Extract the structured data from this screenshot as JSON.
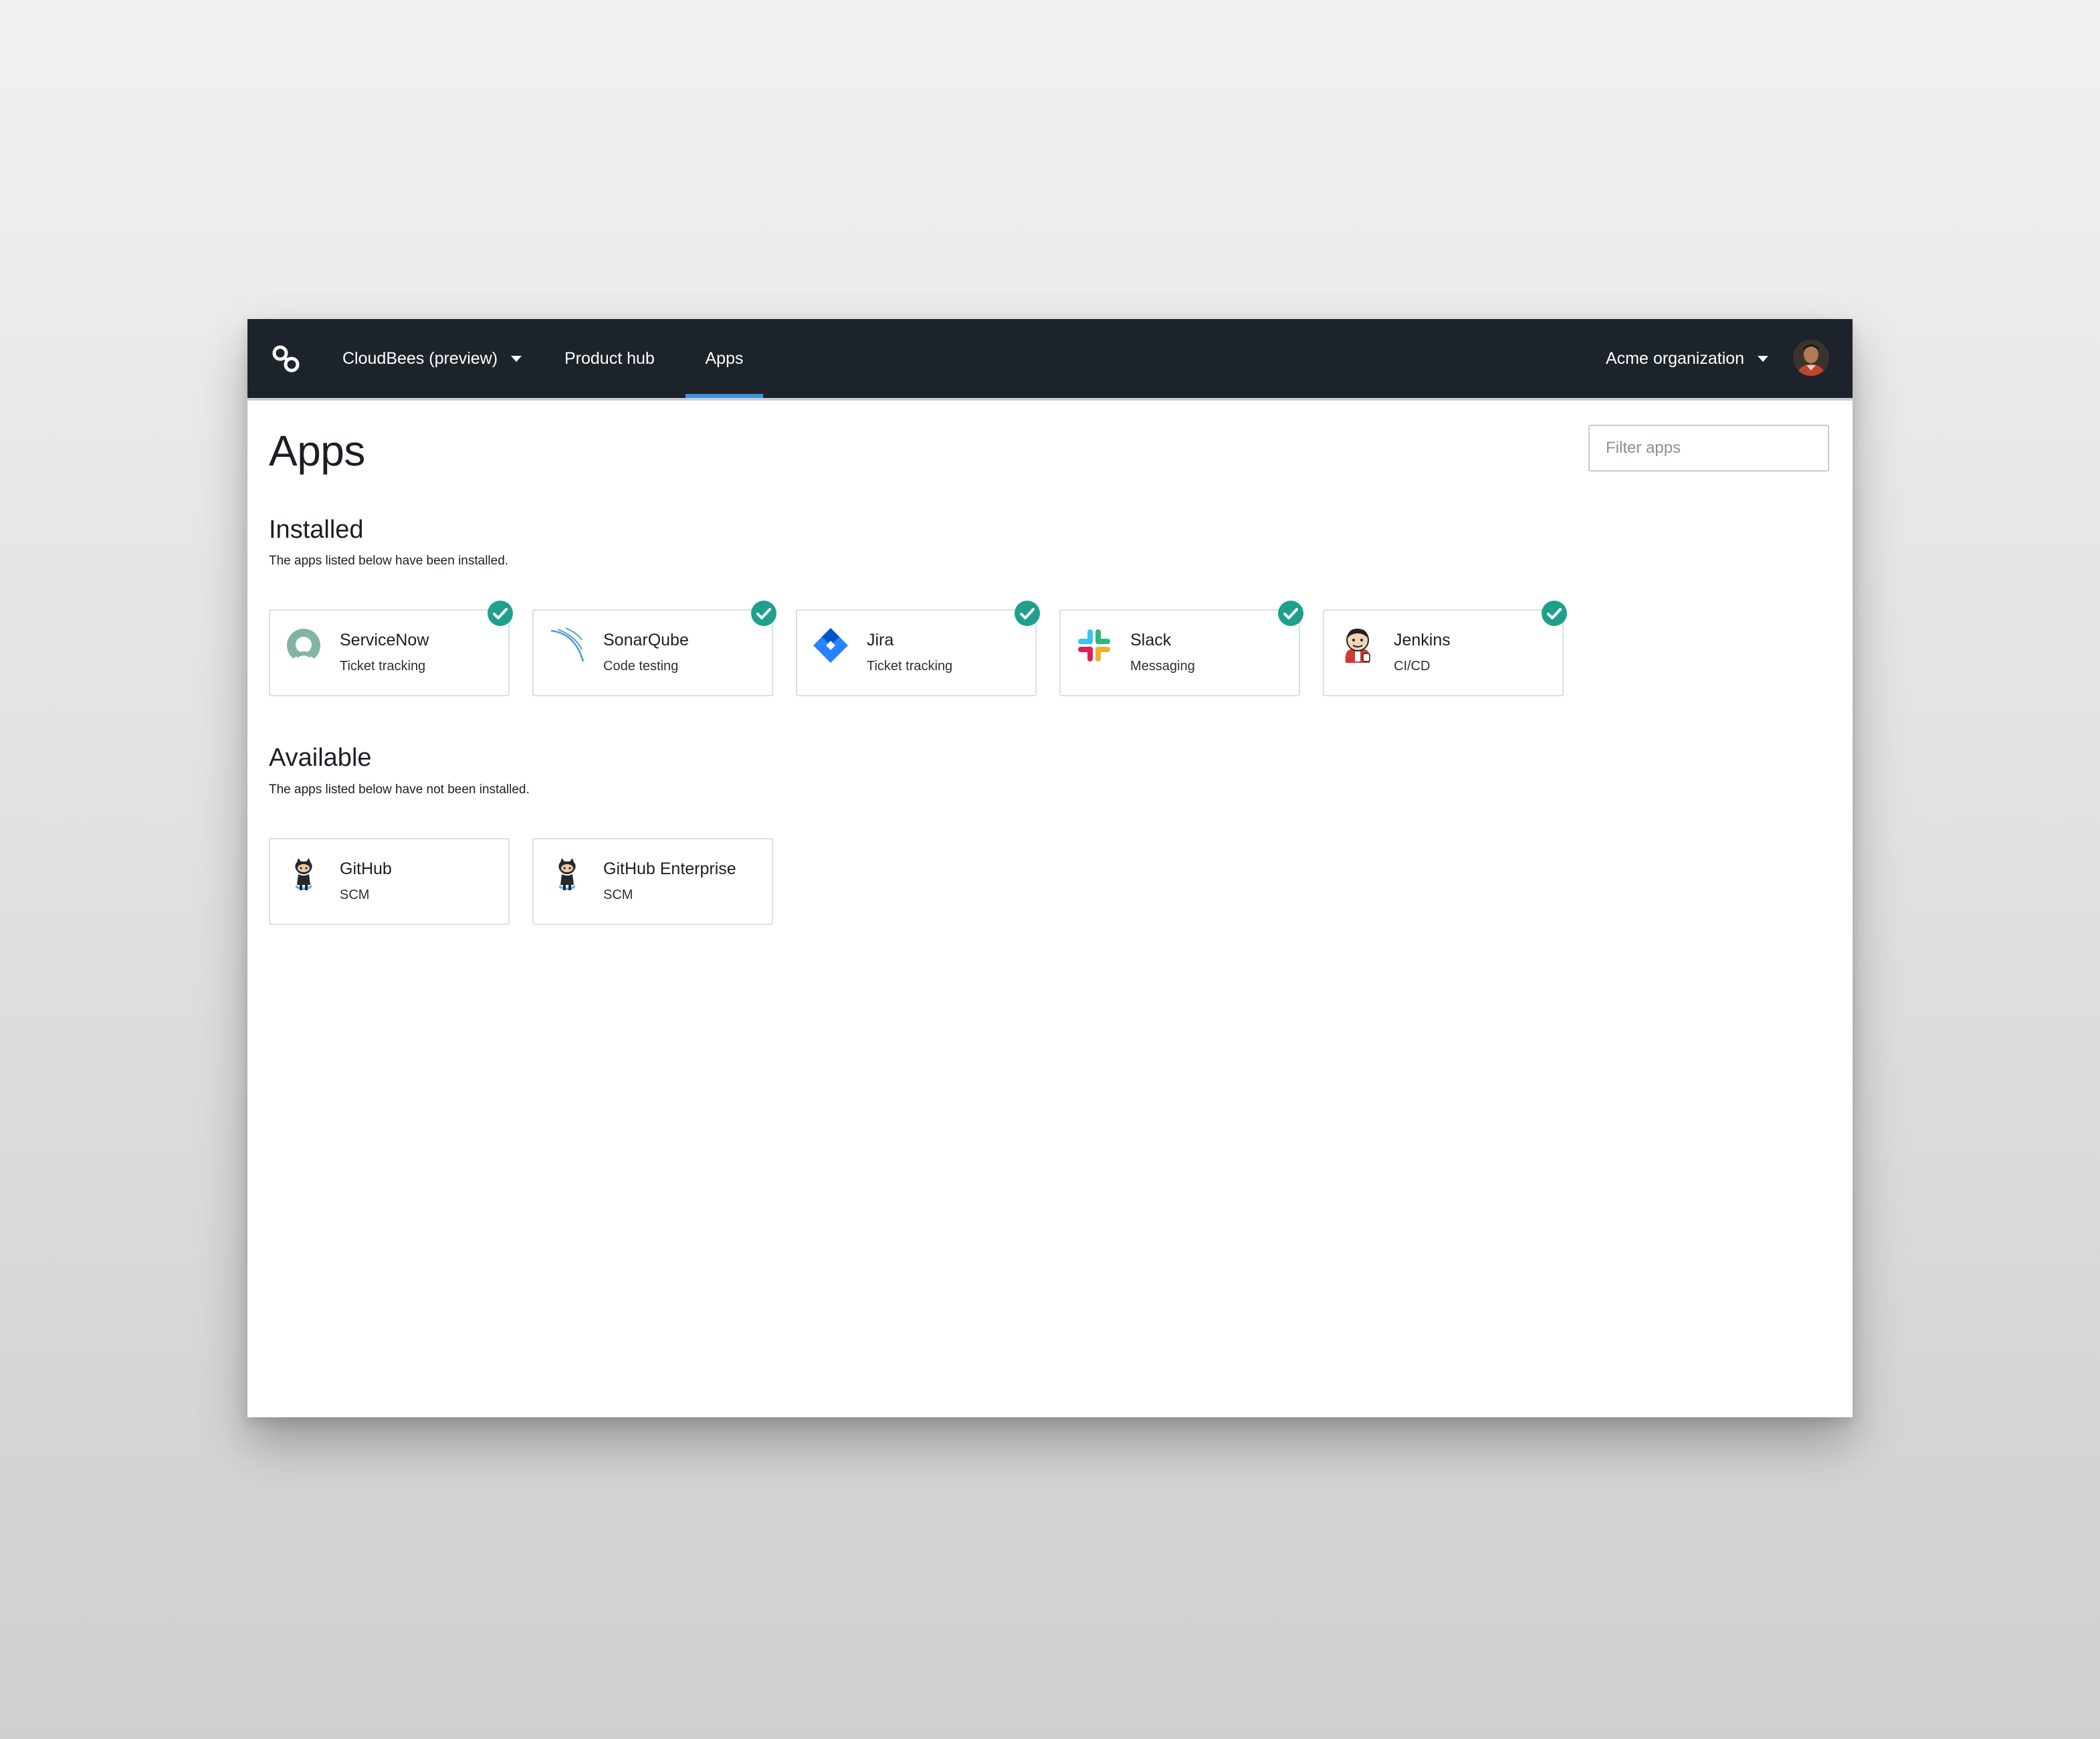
{
  "nav": {
    "product": "CloudBees (preview)",
    "product_hub": "Product hub",
    "apps": "Apps",
    "organization": "Acme organization"
  },
  "page": {
    "title": "Apps",
    "filter_placeholder": "Filter apps"
  },
  "installed": {
    "title": "Installed",
    "description": "The apps listed below have been installed.",
    "apps": [
      {
        "name": "ServiceNow",
        "category": "Ticket tracking",
        "icon": "servicenow-icon"
      },
      {
        "name": "SonarQube",
        "category": "Code testing",
        "icon": "sonarqube-icon"
      },
      {
        "name": "Jira",
        "category": "Ticket tracking",
        "icon": "jira-icon"
      },
      {
        "name": "Slack",
        "category": "Messaging",
        "icon": "slack-icon"
      },
      {
        "name": "Jenkins",
        "category": "CI/CD",
        "icon": "jenkins-icon"
      }
    ]
  },
  "available": {
    "title": "Available",
    "description": "The apps listed below have not been installed.",
    "apps": [
      {
        "name": "GitHub",
        "category": "SCM",
        "icon": "github-icon"
      },
      {
        "name": "GitHub Enterprise",
        "category": "SCM",
        "icon": "github-icon"
      }
    ]
  },
  "colors": {
    "nav_background": "#1d232b",
    "active_tab_accent": "#3d95d8",
    "installed_check": "#1fa08b"
  }
}
